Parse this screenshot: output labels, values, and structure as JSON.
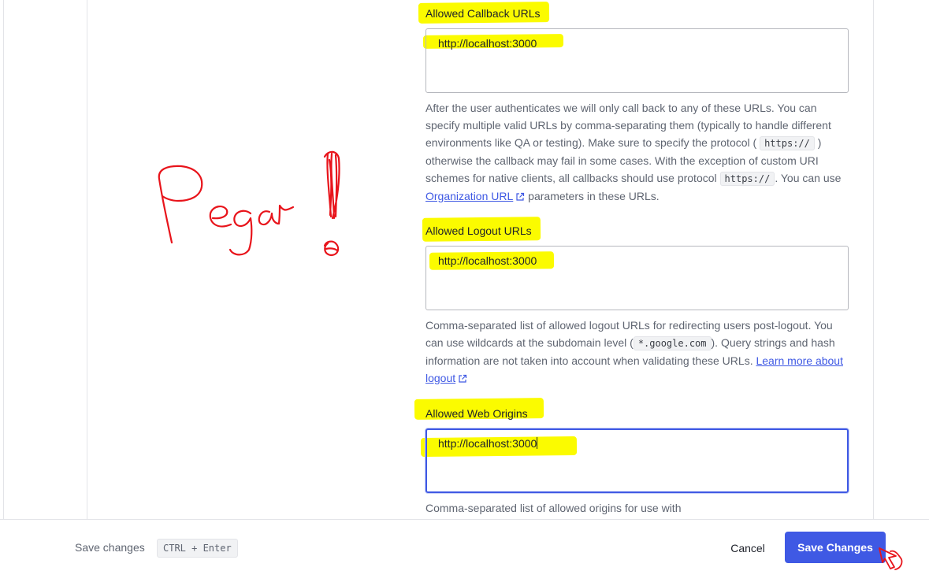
{
  "callback": {
    "label": "Allowed Callback URLs",
    "value": "http://localhost:3000",
    "help_1": "After the user authenticates we will only call back to any of these URLs. You can specify multiple valid URLs by comma-separating them (typically to handle different environments like QA or testing). Make sure to specify the protocol (",
    "code_1": "https://",
    "help_2": ") otherwise the callback may fail in some cases. With the exception of custom URI schemes for native clients, all callbacks should use protocol",
    "code_2": "https://",
    "help_3": ". You can use",
    "link": "Organization URL",
    "help_4": "parameters in these URLs."
  },
  "logout": {
    "label": "Allowed Logout URLs",
    "value": "http://localhost:3000",
    "help_1": "Comma-separated list of allowed logout URLs for redirecting users post-logout. You can use wildcards at the subdomain level (",
    "code_1": "*.google.com",
    "help_2": "). Query strings and hash information are not taken into account when validating these URLs.",
    "link": "Learn more about logout"
  },
  "web_origins": {
    "label": "Allowed Web Origins",
    "value": "http://localhost:3000",
    "help": "Comma-separated list of allowed origins for use with"
  },
  "footer": {
    "save_label": "Save changes",
    "shortcut": "CTRL + Enter",
    "cancel_label": "Cancel",
    "save_button": "Save Changes"
  },
  "annotation": {
    "handwritten_text": "Pegar!",
    "highlight_color": "#fbfb00",
    "ink_color": "#e8141b"
  },
  "colors": {
    "accent": "#3f59e4",
    "text": "#1e212a",
    "muted": "#5f6571",
    "border": "#b6b8be"
  }
}
